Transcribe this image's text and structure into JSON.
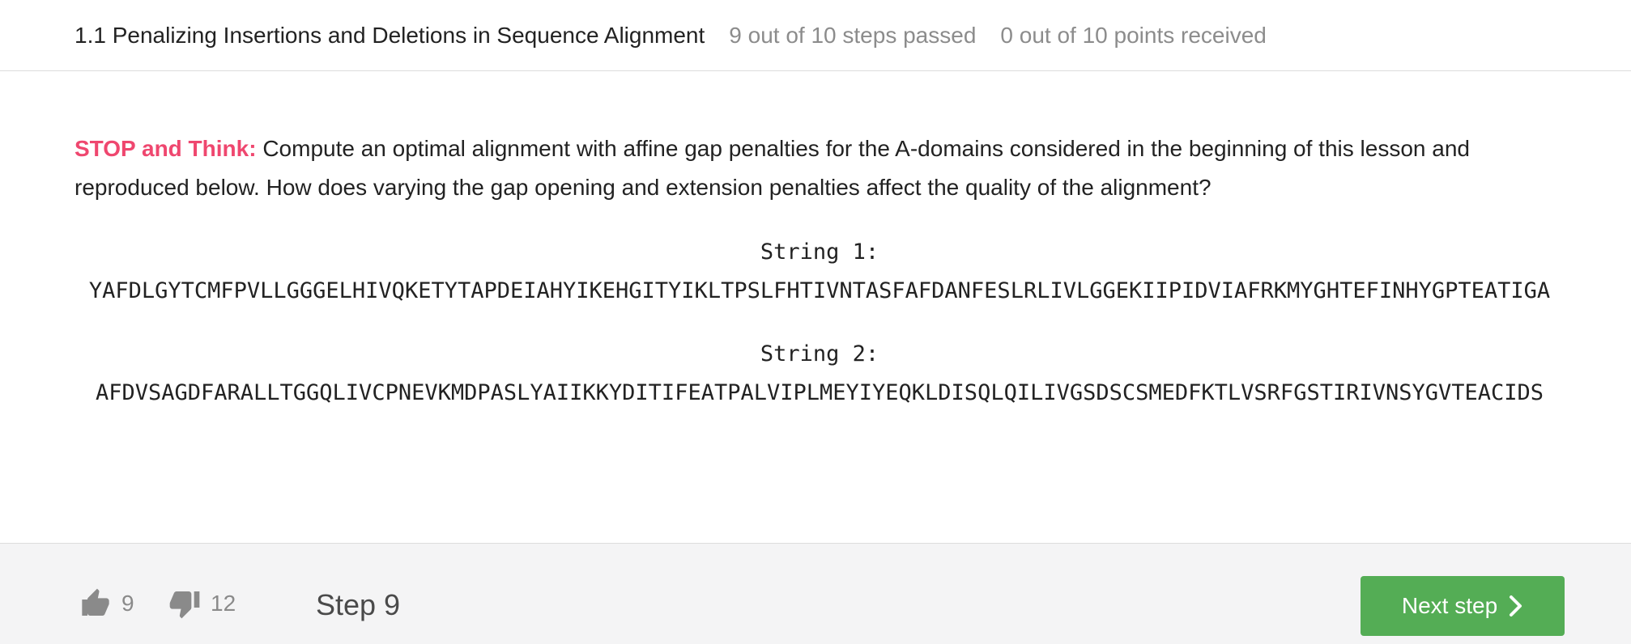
{
  "header": {
    "title": "1.1 Penalizing Insertions and Deletions in Sequence Alignment",
    "steps_passed": "9 out of 10 steps passed",
    "points_received": "0 out of 10 points  received"
  },
  "content": {
    "stop_label": "STOP and Think:",
    "prompt_text": " Compute an optimal alignment with affine gap penalties for the A-domains considered in the beginning of this lesson and reproduced below. How does varying the gap opening and extension penalties affect the quality of the alignment?",
    "string1_label": "String 1:",
    "string1_value": "YAFDLGYTCMFPVLLGGGELHIVQKETYTAPDEIAHYIKEHGITYIKLTPSLFHTIVNTASFAFDANFESLRLIVLGGEKIIPIDVIAFRKMYGHTEFINHYGPTEATIGA",
    "string2_label": "String 2:",
    "string2_value": "AFDVSAGDFARALLTGGQLIVCPNEVKMDPASLYAIIKKYDITIFEATPALVIPLMEYIYEQKLDISQLQILIVGSDSCSMEDFKTLVSRFGSTIRIVNSYGVTEACIDS"
  },
  "footer": {
    "likes": "9",
    "dislikes": "12",
    "step_label": "Step 9",
    "next_button": "Next step"
  },
  "colors": {
    "stop_accent": "#ef476f",
    "next_button": "#54ad55",
    "muted_text": "#8c8c8c",
    "footer_bg": "#f4f4f5"
  },
  "icons": [
    "thumbs-up-icon",
    "thumbs-down-icon",
    "chevron-right-icon"
  ]
}
